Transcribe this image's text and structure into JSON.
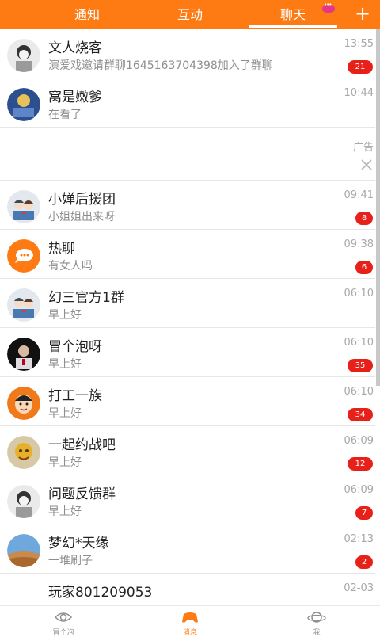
{
  "tabs": {
    "notice": "通知",
    "interact": "互动",
    "chat": "聊天"
  },
  "colors": {
    "accent": "#fe7a12",
    "badge": "#e8201a"
  },
  "conversations_top": [
    {
      "title": "文人烧客",
      "preview": "演爱戏邀请群聊1645163704398加入了群聊",
      "time": "13:55",
      "badge": "21"
    },
    {
      "title": "窝是嫩爹",
      "preview": "在看了",
      "time": "10:44",
      "badge": ""
    }
  ],
  "ad": {
    "label": "广告",
    "close_icon": "close-icon"
  },
  "conversations": [
    {
      "title": "小婵后援团",
      "preview": "小姐姐出来呀",
      "time": "09:41",
      "badge": "8"
    },
    {
      "title": "热聊",
      "preview": "有女人吗",
      "time": "09:38",
      "badge": "6"
    },
    {
      "title": "幻三官方1群",
      "preview": "早上好",
      "time": "06:10",
      "badge": ""
    },
    {
      "title": "冒个泡呀",
      "preview": "早上好",
      "time": "06:10",
      "badge": "35"
    },
    {
      "title": "打工一族",
      "preview": "早上好",
      "time": "06:10",
      "badge": "34"
    },
    {
      "title": "一起约战吧",
      "preview": "早上好",
      "time": "06:09",
      "badge": "12"
    },
    {
      "title": "问题反馈群",
      "preview": "早上好",
      "time": "06:09",
      "badge": "7"
    },
    {
      "title": "梦幻*天缘",
      "preview": "一堆刷子",
      "time": "02:13",
      "badge": "2"
    },
    {
      "title": "玩家801209053",
      "preview": "",
      "time": "02-03",
      "badge": ""
    }
  ],
  "bottom_nav": {
    "bubble": "冒个泡",
    "messages": "消息",
    "me": "我"
  }
}
